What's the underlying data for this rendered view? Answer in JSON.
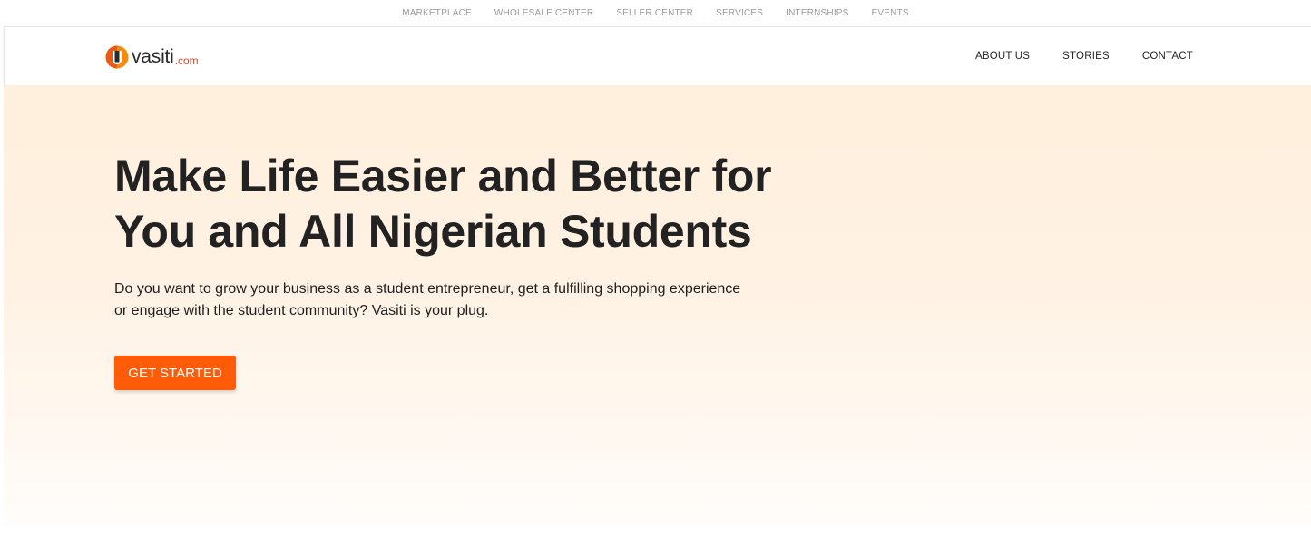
{
  "top_links": [
    "MARKETPLACE",
    "WHOLESALE CENTER",
    "SELLER CENTER",
    "SERVICES",
    "INTERNSHIPS",
    "EVENTS"
  ],
  "header": {
    "logo": {
      "name": "vasiti",
      "tld": ".com",
      "icon": "vasiti-logo-icon"
    },
    "nav": [
      "ABOUT US",
      "STORIES",
      "CONTACT"
    ]
  },
  "hero": {
    "title": "Make Life Easier and Better for You and All Nigerian Students",
    "description": "Do you want to grow your business as a student entrepreneur, get a fulfilling shopping experience or engage with the student community? Vasiti is your plug.",
    "cta_label": "GET STARTED"
  },
  "colors": {
    "accent": "#ff5c0a",
    "hero_bg": "#ffefdc",
    "logo_tld": "#e8401c"
  }
}
